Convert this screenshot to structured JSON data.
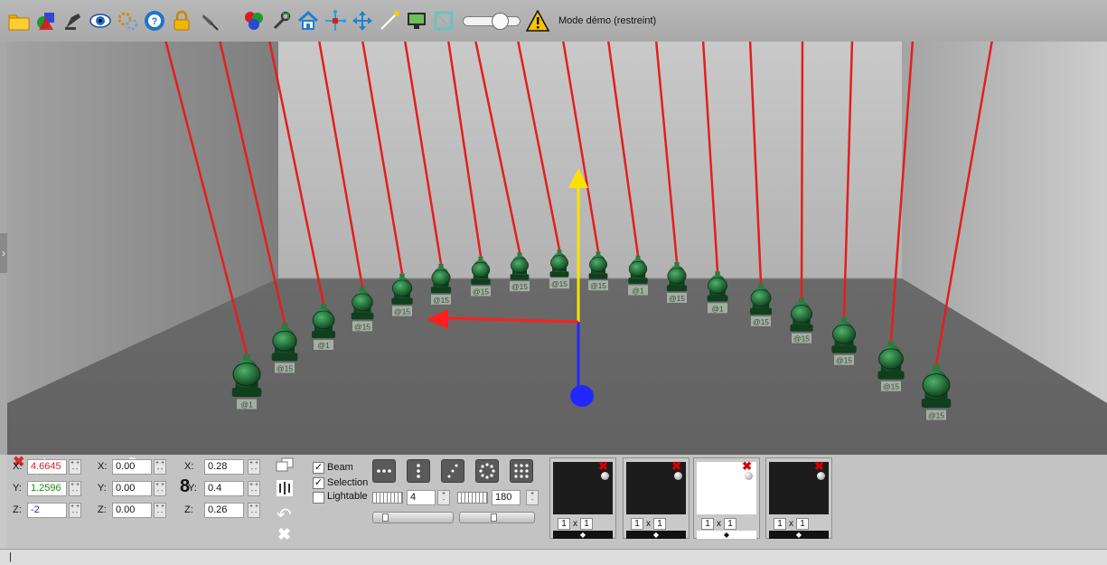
{
  "toolbar": {
    "icons": [
      "folder-icon",
      "shapes-icon",
      "spotlight-icon",
      "eye-icon",
      "gears-icon",
      "help-icon",
      "lock-icon",
      "pin-icon",
      "colors-icon",
      "wrench-icon",
      "home-icon",
      "move-arrows-icon",
      "move-cross-icon",
      "laser-icon",
      "screen-icon",
      "frame-icon"
    ],
    "zoom_level": 0.72,
    "warning_text": "Mode démo (restreint)",
    "accent_color": "#f5c400"
  },
  "scene": {
    "fixture_labels": [
      "@1",
      "@15",
      "@1",
      "@15",
      "@15",
      "@15",
      "@15",
      "@15",
      "@15",
      "@15",
      "@1",
      "@15",
      "@1",
      "@15",
      "@15",
      "@15",
      "@15",
      "@15",
      "@15"
    ],
    "beam_color": "#e41e1e",
    "axis_colors": {
      "x": "#ff1e1e",
      "y": "#ffe100",
      "z": "#2028ff"
    }
  },
  "panel": {
    "position": {
      "x_label": "X:",
      "x": "4.6645",
      "y_label": "Y:",
      "y": "1.2596",
      "z_label": "Z:",
      "z": "-2"
    },
    "rotation": {
      "x_label": "X:",
      "x": "0.00",
      "y_label": "Y:",
      "y": "0.00",
      "z_label": "Z:",
      "z": "0.00"
    },
    "size": {
      "x_label": "X:",
      "x": "0.28",
      "y_label": "Y:",
      "y": "0.4",
      "z_label": "Z:",
      "z": "0.26"
    },
    "checks": {
      "beam": "Beam",
      "selection": "Selection",
      "lightable": "Lightable"
    },
    "spacing_value": "4",
    "angle_value": "180",
    "previews": [
      {
        "w": "1",
        "x": "x",
        "h": "1",
        "white": false
      },
      {
        "w": "1",
        "x": "x",
        "h": "1",
        "white": false
      },
      {
        "w": "1",
        "x": "x",
        "h": "1",
        "white": true
      },
      {
        "w": "1",
        "x": "x",
        "h": "1",
        "white": false
      }
    ]
  },
  "status": {
    "text": "|"
  }
}
